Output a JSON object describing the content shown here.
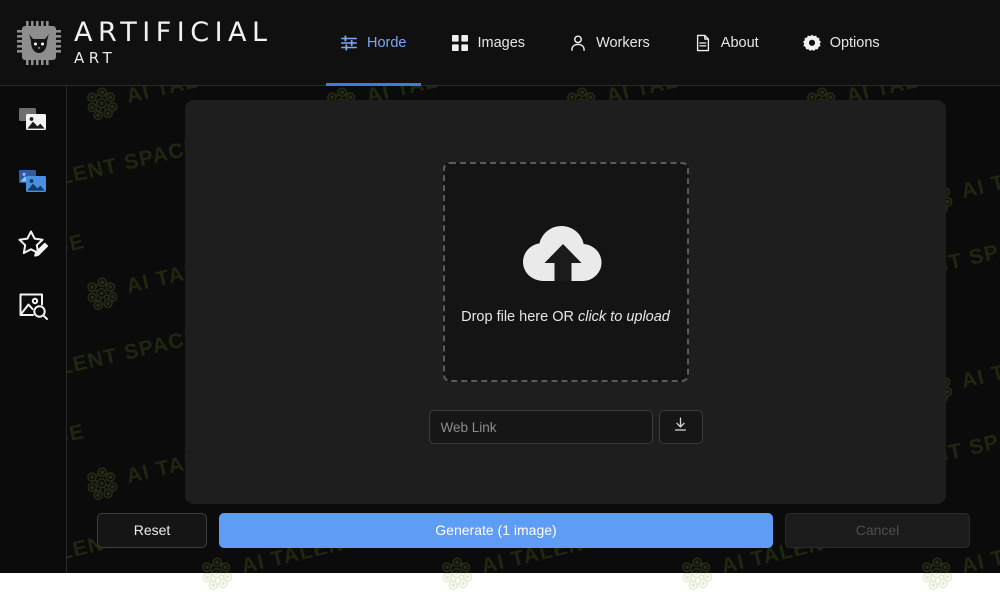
{
  "app": {
    "brand": {
      "line1": "ARTIFICIAL",
      "line2": "ART",
      "logo_icon": "cat-chip-logo-icon"
    },
    "nav": [
      {
        "label": "Horde",
        "icon": "sliders-icon",
        "active": true
      },
      {
        "label": "Images",
        "icon": "grid-icon",
        "active": false
      },
      {
        "label": "Workers",
        "icon": "person-icon",
        "active": false
      },
      {
        "label": "About",
        "icon": "document-icon",
        "active": false
      },
      {
        "label": "Options",
        "icon": "gear-icon",
        "active": false
      }
    ],
    "sidebar": [
      {
        "name": "text-to-image",
        "icon": "images-stack-icon",
        "active": false
      },
      {
        "name": "image-to-image",
        "icon": "images-stack-icon",
        "active": true
      },
      {
        "name": "inpainting",
        "icon": "star-pencil-icon",
        "active": false
      },
      {
        "name": "image-search",
        "icon": "image-search-icon",
        "active": false
      }
    ],
    "dropzone": {
      "icon": "cloud-upload-icon",
      "text_plain": "Drop file here OR ",
      "text_emphasis": "click to upload"
    },
    "weblink": {
      "placeholder": "Web Link",
      "value": "",
      "button_icon": "download-icon"
    },
    "footer": {
      "reset_label": "Reset",
      "generate_label": "Generate (1 image)",
      "cancel_label": "Cancel"
    },
    "colors": {
      "accent_blue": "#5f9cf5",
      "tab_active_text": "#7aa9ef",
      "tab_underline": "#3b7ddd",
      "panel_bg": "#1e1e1e",
      "app_bg": "#0b0b0b",
      "sidebar_active_icon": "#4a90e2"
    },
    "watermark": {
      "text": "AI TALENT SPACE",
      "logo_icon": "brain-network-icon"
    }
  }
}
